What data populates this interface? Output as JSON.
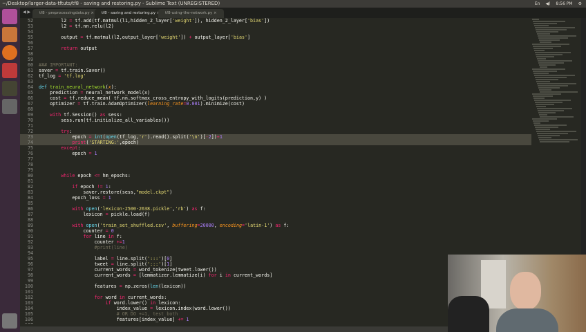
{
  "window_title": "~/Desktop/larger-data-tftuts/tf8 - saving and restoring.py - Sublime Text (UNREGISTERED)",
  "tray": {
    "clock": "8:56 PM",
    "lang": "En"
  },
  "tabs": [
    {
      "label": "tf8 - preprocessingdata.py"
    },
    {
      "label": "tf8 - saving and restoring.py"
    },
    {
      "label": "tf8-using-the-network.py"
    }
  ],
  "code": [
    {
      "n": "52",
      "s": [
        [
          "t",
          "        l2 "
        ],
        [
          "k",
          "="
        ],
        [
          "t",
          " tf.add(tf.matmul(l1,hidden_2_layer["
        ],
        [
          "s",
          "'weight'"
        ],
        [
          "t",
          "]), hidden_2_layer["
        ],
        [
          "s",
          "'bias'"
        ],
        [
          "t",
          "])"
        ]
      ]
    },
    {
      "n": "53",
      "s": [
        [
          "t",
          "        l2 "
        ],
        [
          "k",
          "="
        ],
        [
          "t",
          " tf.nn.relu(l2)"
        ]
      ]
    },
    {
      "n": "54",
      "s": []
    },
    {
      "n": "55",
      "s": [
        [
          "t",
          "        output "
        ],
        [
          "k",
          "="
        ],
        [
          "t",
          " tf.matmul(l2,output_layer["
        ],
        [
          "s",
          "'weight'"
        ],
        [
          "t",
          "]) "
        ],
        [
          "k",
          "+"
        ],
        [
          "t",
          " output_layer["
        ],
        [
          "s",
          "'bias'"
        ],
        [
          "t",
          "]"
        ]
      ]
    },
    {
      "n": "56",
      "s": []
    },
    {
      "n": "57",
      "s": [
        [
          "k",
          "        return"
        ],
        [
          "t",
          " output"
        ]
      ]
    },
    {
      "n": "58",
      "s": []
    },
    {
      "n": "59",
      "s": []
    },
    {
      "n": "60",
      "s": [
        [
          "c",
          "### IMPORTANT:"
        ]
      ]
    },
    {
      "n": "61",
      "s": [
        [
          "t",
          "saver "
        ],
        [
          "k",
          "="
        ],
        [
          "t",
          " tf.train.Saver()"
        ]
      ]
    },
    {
      "n": "62",
      "s": [
        [
          "t",
          "tf_log "
        ],
        [
          "k",
          "="
        ],
        [
          "s",
          " 'tf.log'"
        ]
      ]
    },
    {
      "n": "63",
      "s": []
    },
    {
      "n": "64",
      "s": [
        [
          "f",
          "def"
        ],
        [
          "d",
          " train_neural_network"
        ],
        [
          "t",
          "("
        ],
        [
          "p",
          "x"
        ],
        [
          "t",
          "):"
        ]
      ]
    },
    {
      "n": "65",
      "s": [
        [
          "t",
          "    prediction "
        ],
        [
          "k",
          "="
        ],
        [
          "t",
          " neural_network_model(x)"
        ]
      ]
    },
    {
      "n": "66",
      "s": [
        [
          "t",
          "    cost "
        ],
        [
          "k",
          "="
        ],
        [
          "t",
          " tf.reduce_mean( tf.nn.softmax_cross_entropy_with_logits(prediction,y) )"
        ]
      ]
    },
    {
      "n": "67",
      "s": [
        [
          "t",
          "    optimizer "
        ],
        [
          "k",
          "="
        ],
        [
          "t",
          " tf.train.AdamOptimizer("
        ],
        [
          "p",
          "learning_rate"
        ],
        [
          "k",
          "="
        ],
        [
          "n",
          "0.001"
        ],
        [
          "t",
          ").minimize(cost)"
        ]
      ]
    },
    {
      "n": "68",
      "s": []
    },
    {
      "n": "69",
      "s": [
        [
          "k",
          "    with"
        ],
        [
          "t",
          " tf.Session() "
        ],
        [
          "k",
          "as"
        ],
        [
          "t",
          " sess:"
        ]
      ]
    },
    {
      "n": "70",
      "s": [
        [
          "t",
          "        sess.run(tf.initialize_all_variables())"
        ]
      ]
    },
    {
      "n": "71",
      "s": []
    },
    {
      "n": "72",
      "s": [
        [
          "k",
          "        try"
        ],
        [
          "t",
          ":"
        ]
      ]
    },
    {
      "n": "73",
      "s": [
        [
          "t",
          "            epoch "
        ],
        [
          "k",
          "="
        ],
        [
          "f",
          " int"
        ],
        [
          "t",
          "("
        ],
        [
          "f",
          "open"
        ],
        [
          "t",
          "(tf_log,"
        ],
        [
          "s",
          "'r'"
        ],
        [
          "t",
          ").read().split("
        ],
        [
          "s",
          "'\\n'"
        ],
        [
          "t",
          ")["
        ],
        [
          "k",
          "-"
        ],
        [
          "n",
          "2"
        ],
        [
          "t",
          "])"
        ],
        [
          "k",
          "+"
        ],
        [
          "n",
          "1"
        ]
      ],
      "sel": true
    },
    {
      "n": "74",
      "s": [
        [
          "k",
          "            print"
        ],
        [
          "t",
          "("
        ],
        [
          "s",
          "'STARTING:'"
        ],
        [
          "t",
          ",epoch)"
        ]
      ],
      "sel": true
    },
    {
      "n": "75",
      "s": [
        [
          "k",
          "        except"
        ],
        [
          "t",
          ":"
        ]
      ]
    },
    {
      "n": "76",
      "s": [
        [
          "t",
          "            epoch "
        ],
        [
          "k",
          "="
        ],
        [
          "n",
          " 1"
        ]
      ]
    },
    {
      "n": "77",
      "s": []
    },
    {
      "n": "78",
      "s": []
    },
    {
      "n": "79",
      "s": []
    },
    {
      "n": "80",
      "s": [
        [
          "k",
          "        while"
        ],
        [
          "t",
          " epoch "
        ],
        [
          "k",
          "<="
        ],
        [
          "t",
          " hm_epochs:"
        ]
      ]
    },
    {
      "n": "81",
      "s": []
    },
    {
      "n": "82",
      "s": [
        [
          "k",
          "            if"
        ],
        [
          "t",
          " epoch "
        ],
        [
          "k",
          "!="
        ],
        [
          "n",
          " 1"
        ],
        [
          "t",
          ":"
        ]
      ]
    },
    {
      "n": "83",
      "s": [
        [
          "t",
          "                saver.restore(sess,"
        ],
        [
          "s",
          "\"model.ckpt\""
        ],
        [
          "t",
          ")"
        ]
      ]
    },
    {
      "n": "84",
      "s": [
        [
          "t",
          "            epoch_loss "
        ],
        [
          "k",
          "="
        ],
        [
          "n",
          " 1"
        ]
      ]
    },
    {
      "n": "85",
      "s": []
    },
    {
      "n": "86",
      "s": [
        [
          "k",
          "            with"
        ],
        [
          "f",
          " open"
        ],
        [
          "t",
          "("
        ],
        [
          "s",
          "'lexicon-2500-2638.pickle'"
        ],
        [
          "t",
          ","
        ],
        [
          "s",
          "'rb'"
        ],
        [
          "t",
          ") "
        ],
        [
          "k",
          "as"
        ],
        [
          "t",
          " f:"
        ]
      ]
    },
    {
      "n": "87",
      "s": [
        [
          "t",
          "                lexicon "
        ],
        [
          "k",
          "="
        ],
        [
          "t",
          " pickle.load(f)"
        ]
      ]
    },
    {
      "n": "88",
      "s": []
    },
    {
      "n": "89",
      "s": [
        [
          "k",
          "            with"
        ],
        [
          "f",
          " open"
        ],
        [
          "t",
          "("
        ],
        [
          "s",
          "'train_set_shuffled.csv'"
        ],
        [
          "t",
          ", "
        ],
        [
          "p",
          "buffering"
        ],
        [
          "k",
          "="
        ],
        [
          "n",
          "20000"
        ],
        [
          "t",
          ", "
        ],
        [
          "p",
          "encoding"
        ],
        [
          "k",
          "="
        ],
        [
          "s",
          "'latin-1'"
        ],
        [
          "t",
          ") "
        ],
        [
          "k",
          "as"
        ],
        [
          "t",
          " f:"
        ]
      ]
    },
    {
      "n": "90",
      "s": [
        [
          "t",
          "                counter "
        ],
        [
          "k",
          "="
        ],
        [
          "n",
          " 0"
        ]
      ]
    },
    {
      "n": "91",
      "s": [
        [
          "k",
          "                for"
        ],
        [
          "t",
          " line "
        ],
        [
          "k",
          "in"
        ],
        [
          "t",
          " f:"
        ]
      ]
    },
    {
      "n": "92",
      "s": [
        [
          "t",
          "                    counter "
        ],
        [
          "k",
          "+="
        ],
        [
          "n",
          "1"
        ]
      ]
    },
    {
      "n": "93",
      "s": [
        [
          "c",
          "                    #print(line)"
        ]
      ]
    },
    {
      "n": "94",
      "s": []
    },
    {
      "n": "95",
      "s": [
        [
          "t",
          "                    label "
        ],
        [
          "k",
          "="
        ],
        [
          "t",
          " line.split("
        ],
        [
          "s",
          "':::'"
        ],
        [
          "t",
          ")["
        ],
        [
          "n",
          "0"
        ],
        [
          "t",
          "]"
        ]
      ]
    },
    {
      "n": "96",
      "s": [
        [
          "t",
          "                    tweet "
        ],
        [
          "k",
          "="
        ],
        [
          "t",
          " line.split("
        ],
        [
          "s",
          "':::'"
        ],
        [
          "t",
          ")["
        ],
        [
          "n",
          "1"
        ],
        [
          "t",
          "]"
        ]
      ]
    },
    {
      "n": "97",
      "s": [
        [
          "t",
          "                    current_words "
        ],
        [
          "k",
          "="
        ],
        [
          "t",
          " word_tokenize(tweet.lower())"
        ]
      ]
    },
    {
      "n": "98",
      "s": [
        [
          "t",
          "                    current_words "
        ],
        [
          "k",
          "="
        ],
        [
          "t",
          " [lemmatizer.lemmatize(i) "
        ],
        [
          "k",
          "for"
        ],
        [
          "t",
          " i "
        ],
        [
          "k",
          "in"
        ],
        [
          "t",
          " current_words]"
        ]
      ]
    },
    {
      "n": "99",
      "s": []
    },
    {
      "n": "100",
      "s": [
        [
          "t",
          "                    features "
        ],
        [
          "k",
          "="
        ],
        [
          "t",
          " np.zeros("
        ],
        [
          "f",
          "len"
        ],
        [
          "t",
          "(lexicon))"
        ]
      ]
    },
    {
      "n": "101",
      "s": []
    },
    {
      "n": "102",
      "s": [
        [
          "k",
          "                    for"
        ],
        [
          "t",
          " word "
        ],
        [
          "k",
          "in"
        ],
        [
          "t",
          " current_words:"
        ]
      ]
    },
    {
      "n": "103",
      "s": [
        [
          "k",
          "                        if"
        ],
        [
          "t",
          " word.lower() "
        ],
        [
          "k",
          "in"
        ],
        [
          "t",
          " lexicon:"
        ]
      ]
    },
    {
      "n": "104",
      "s": [
        [
          "t",
          "                            index_value "
        ],
        [
          "k",
          "="
        ],
        [
          "t",
          " lexicon.index(word.lower())"
        ]
      ]
    },
    {
      "n": "105",
      "s": [
        [
          "c",
          "                            # OR DO +=1, test both"
        ]
      ]
    },
    {
      "n": "106",
      "s": [
        [
          "t",
          "                            features[index_value] "
        ],
        [
          "k",
          "+="
        ],
        [
          "n",
          " 1"
        ]
      ]
    },
    {
      "n": "107",
      "s": []
    }
  ]
}
